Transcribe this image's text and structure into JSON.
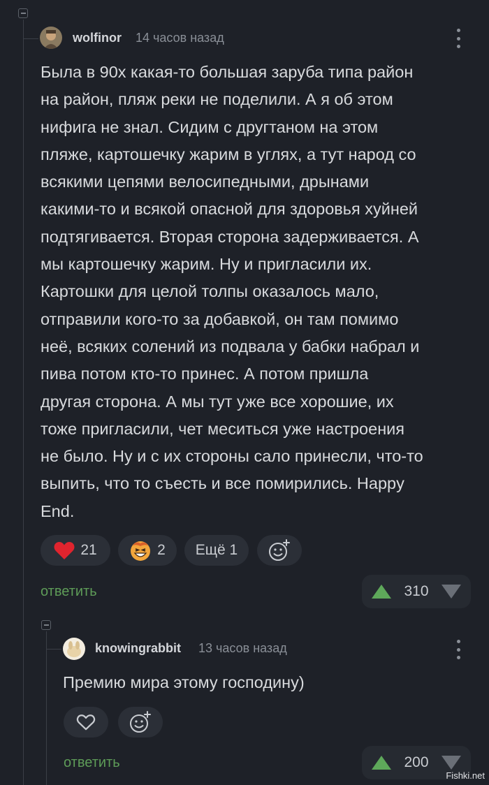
{
  "colors": {
    "background": "#1e2128",
    "accent_green": "#5e9c58",
    "heart_red": "#e0242e",
    "pill_bg": "#2b2f37"
  },
  "comment": {
    "username": "wolfinor",
    "timestamp": "14 часов назад",
    "lines": [
      "Была в 90х какая-то большая заруба типа район",
      "на район, пляж реки не поделили. А я об этом",
      "нифига не знал. Сидим с другтаном на этом",
      "пляже, картошечку жарим в углях, а тут народ со",
      "всякими цепями велосипедными, дрынами",
      "какими-то и всякой опасной для здоровья хуйней",
      "подтягивается. Вторая сторона задерживается. А",
      "мы картошечку жарим. Ну и пригласили их.",
      "Картошки для целой толпы оказалось мало,",
      "отправили кого-то за добавкой, он там помимо",
      "неё, всяких солений из подвала у бабки набрал и",
      "пива потом кто-то принес. А потом пришла",
      "другая сторона. А мы тут уже все хорошие, их",
      "тоже пригласили, чет меситься уже настроения",
      "не было. Ну и с их стороны сало принесли, что-то",
      "выпить, что то съесть и все помирились. Happy",
      "End."
    ],
    "reactions": {
      "heart_count": "21",
      "laugh_count": "2",
      "more_label": "Ещё 1"
    },
    "reply_label": "ответить",
    "rating": "310"
  },
  "reply": {
    "username": "knowingrabbit",
    "timestamp": "13 часов назад",
    "text": "Премию мира этому господину)",
    "reply_label": "ответить",
    "rating": "200"
  },
  "watermark": "Fishki.net",
  "icons": [
    "collapse-icon",
    "avatar",
    "kebab-menu-icon",
    "heart-icon",
    "laugh-emoji-icon",
    "add-reaction-icon",
    "upvote-icon",
    "downvote-icon",
    "heart-outline-icon"
  ]
}
